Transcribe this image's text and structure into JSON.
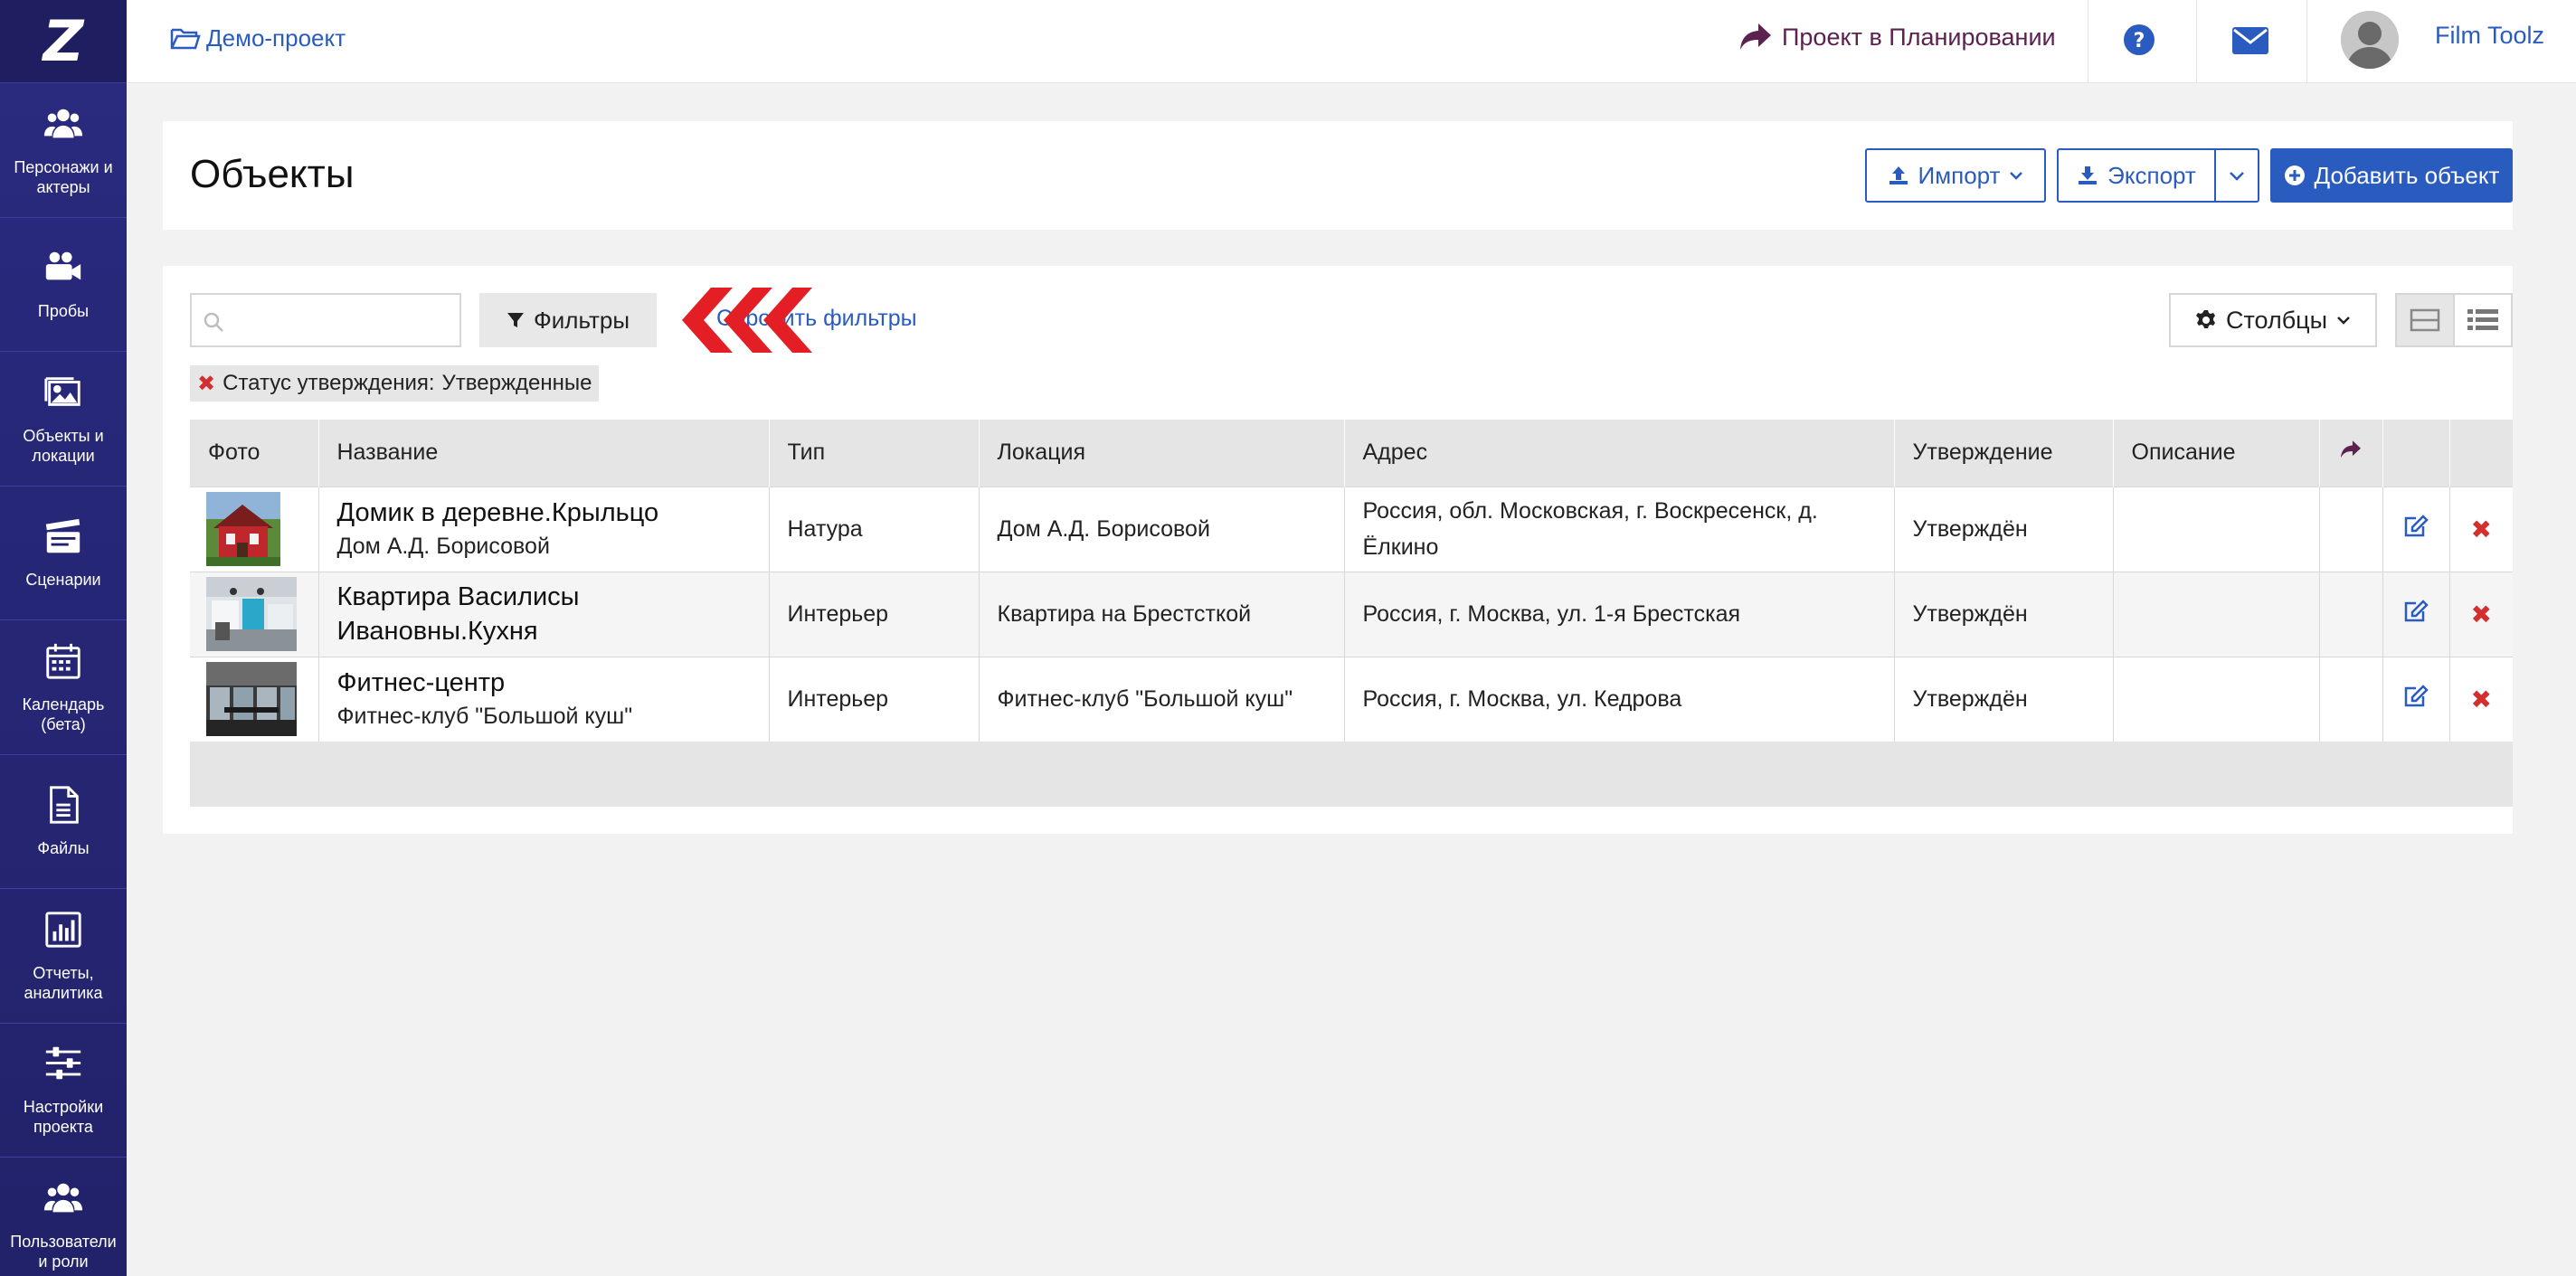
{
  "colors": {
    "sidebar": "#22226a",
    "accent": "#2a5bbf",
    "plan": "#5b2250",
    "delete": "#d32f2f",
    "arrow": "#e31e24"
  },
  "sidebar": {
    "logo": "Z",
    "items": [
      {
        "label": "Персонажи и актеры",
        "icon": "people-icon"
      },
      {
        "label": "Пробы",
        "icon": "video-camera-icon"
      },
      {
        "label": "Объекты и локации",
        "icon": "image-icon"
      },
      {
        "label": "Сценарии",
        "icon": "clapperboard-icon"
      },
      {
        "label": "Календарь (бета)",
        "icon": "calendar-icon"
      },
      {
        "label": "Файлы",
        "icon": "file-icon"
      },
      {
        "label": "Отчеты, аналитика",
        "icon": "bar-chart-icon"
      },
      {
        "label": "Настройки проекта",
        "icon": "sliders-icon"
      },
      {
        "label": "Пользователи и роли",
        "icon": "users-icon"
      }
    ]
  },
  "topbar": {
    "project": "Демо-проект",
    "plan_status": "Проект в Планировании",
    "username": "Film Toolz"
  },
  "header": {
    "title": "Объекты",
    "import_label": "Импорт",
    "export_label": "Экспорт",
    "add_label": "Добавить объект"
  },
  "toolbar": {
    "search_placeholder": "",
    "filters_label": "Фильтры",
    "reset_label": "Сбросить фильтры",
    "columns_label": "Столбцы",
    "chip_key": "Статус утверждения:",
    "chip_value": "Утвержденные"
  },
  "table": {
    "headers": [
      "Фото",
      "Название",
      "Тип",
      "Локация",
      "Адрес",
      "Утверждение",
      "Описание"
    ],
    "rows": [
      {
        "name": "Домик в деревне.Крыльцо",
        "sub": "Дом А.Д. Борисовой",
        "type": "Натура",
        "location": "Дом А.Д. Борисовой",
        "address": "Россия, обл. Московская, г. Воскресенск, д. Ёлкино",
        "approval": "Утверждён",
        "description": ""
      },
      {
        "name": "Квартира Василисы Ивановны.Кухня",
        "sub": "",
        "type": "Интерьер",
        "location": "Квартира на Брестсткой",
        "address": "Россия, г. Москва, ул. 1-я Брестская",
        "approval": "Утверждён",
        "description": ""
      },
      {
        "name": "Фитнес-центр",
        "sub": "Фитнес-клуб \"Большой куш\"",
        "type": "Интерьер",
        "location": "Фитнес-клуб \"Большой куш\"",
        "address": "Россия, г. Москва, ул. Кедрова",
        "approval": "Утверждён",
        "description": ""
      }
    ]
  }
}
